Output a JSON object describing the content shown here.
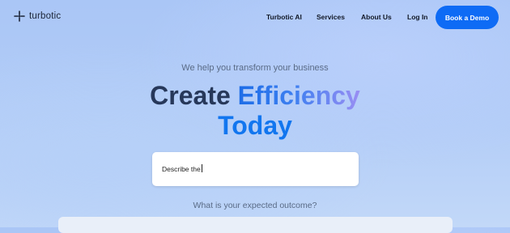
{
  "brand": {
    "name": "turbotic"
  },
  "nav": {
    "items": [
      "Turbotic AI",
      "Services",
      "About Us",
      "Log In"
    ],
    "cta": "Book a Demo"
  },
  "hero": {
    "subheading": "We help you transform your business",
    "title_word1": "Create",
    "title_word2": "Efficiency",
    "title_line2": "Today"
  },
  "prompt": {
    "value": "Describe the"
  },
  "question": "What is your expected outcome?",
  "colors": {
    "accent": "#0e6bf5",
    "title_dark": "#27385a"
  }
}
